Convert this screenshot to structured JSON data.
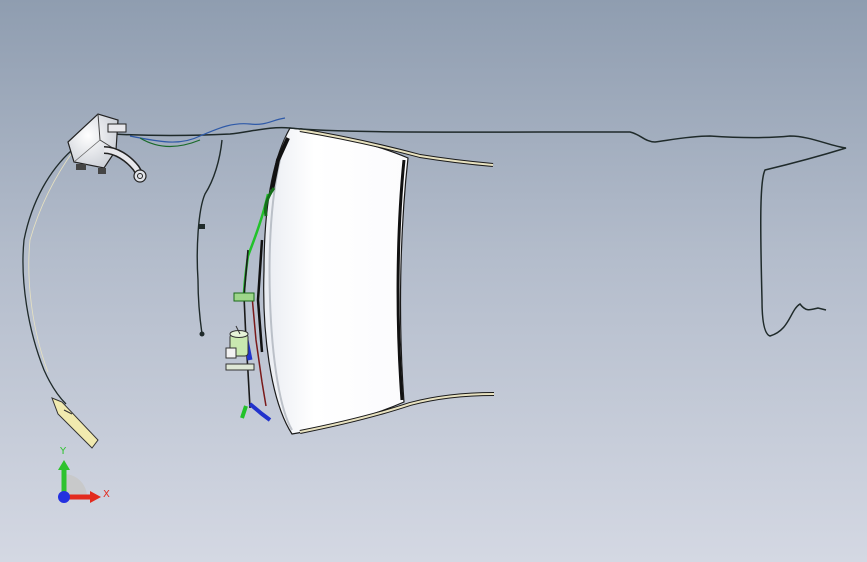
{
  "viewport": {
    "background_top": "#8f9db0",
    "background_bottom": "#d4d8e3"
  },
  "model": {
    "hood_color": "#ffffff",
    "seal_color": "#e8e2c0",
    "hose_color": "#1f2a2a",
    "bracket_color": "#22c22a",
    "motor_color": "#c9e8b0",
    "arm_color": "#2233cc"
  },
  "triad": {
    "x_label": "X",
    "y_label": "Y",
    "x_color": "#e32b1e",
    "y_color": "#2ec22e",
    "z_color": "#2330e0"
  }
}
